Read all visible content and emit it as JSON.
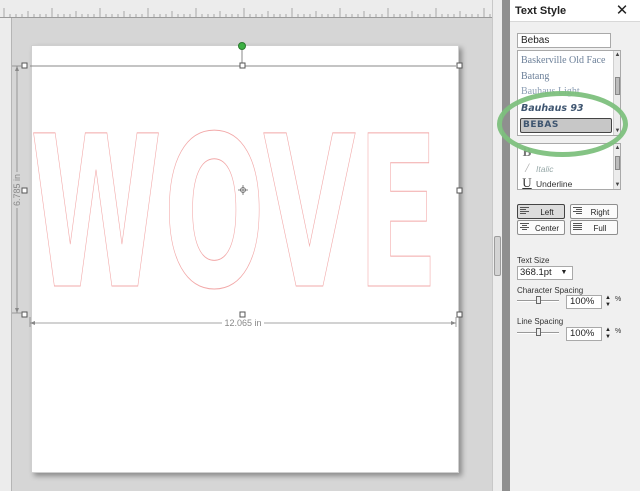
{
  "canvas": {
    "artwork_text": "WOVE",
    "width_dimension": "12.065 in",
    "height_dimension": "6.785 in"
  },
  "panel": {
    "title": "Text Style",
    "close_icon": "close-icon",
    "font_search_value": "Bebas",
    "font_list": {
      "items": [
        "Baskerville Old Face",
        "Batang",
        "Bauhaus Light",
        "Bauhaus 93",
        "BEBAS"
      ],
      "selected": "BEBAS"
    },
    "style_list": {
      "bold_glyph": "B",
      "italic_glyph": "/",
      "italic_label": "Italic",
      "underline_glyph": "U",
      "underline_label": "Underline"
    },
    "alignment": {
      "left": "Left",
      "right": "Right",
      "center": "Center",
      "full": "Full",
      "selected": "Left"
    },
    "text_size": {
      "label": "Text Size",
      "value": "368.1pt"
    },
    "character_spacing": {
      "label": "Character Spacing",
      "value": "100%",
      "unit": "%"
    },
    "line_spacing": {
      "label": "Line Spacing",
      "value": "100%",
      "unit": "%"
    }
  },
  "annotation": {
    "highlight_color": "#7dc07d"
  }
}
